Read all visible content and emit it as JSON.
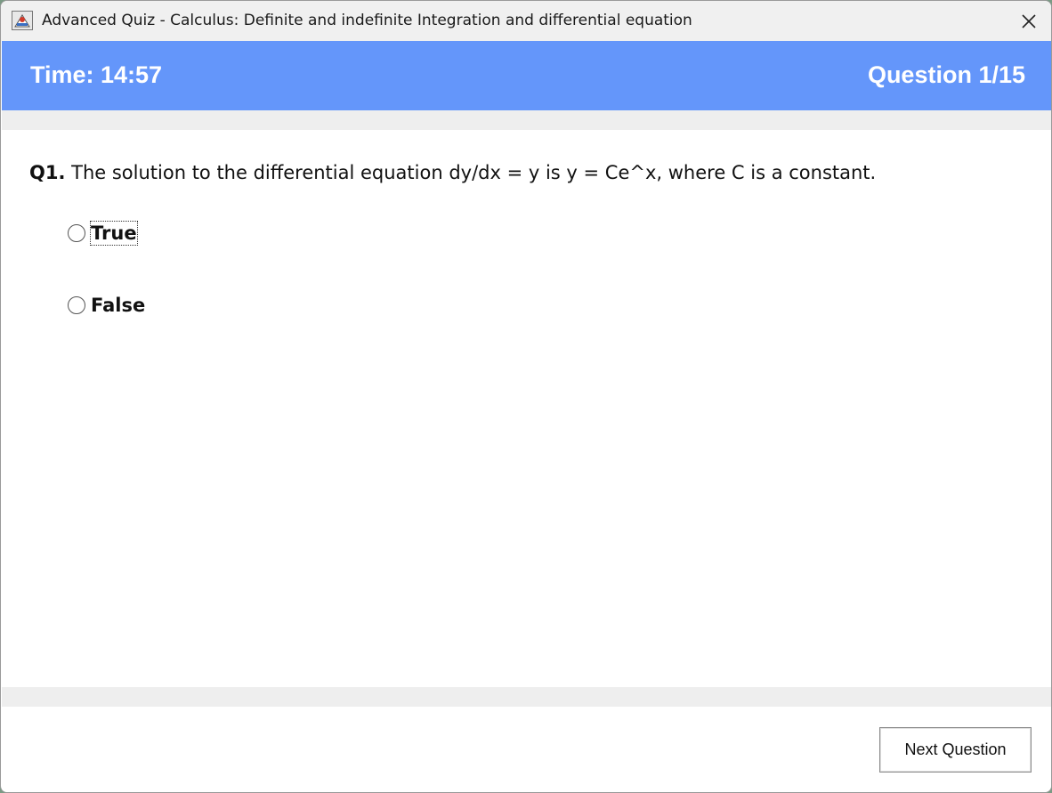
{
  "window": {
    "title": "Advanced Quiz - Calculus: Definite and indefinite Integration and differential equation",
    "app_icon": "java-app-icon",
    "close_icon": "close-icon"
  },
  "header": {
    "timer": "Time: 14:57",
    "question_counter": "Question 1/15",
    "background_color": "#6496fa"
  },
  "question": {
    "number": "Q1.",
    "text": " The solution to the differential equation dy/dx = y is y = Ce^x, where C is a constant."
  },
  "options": [
    {
      "label": "True",
      "selected": false,
      "focused": true
    },
    {
      "label": "False",
      "selected": false,
      "focused": false
    }
  ],
  "footer": {
    "next_button": "Next Question"
  }
}
